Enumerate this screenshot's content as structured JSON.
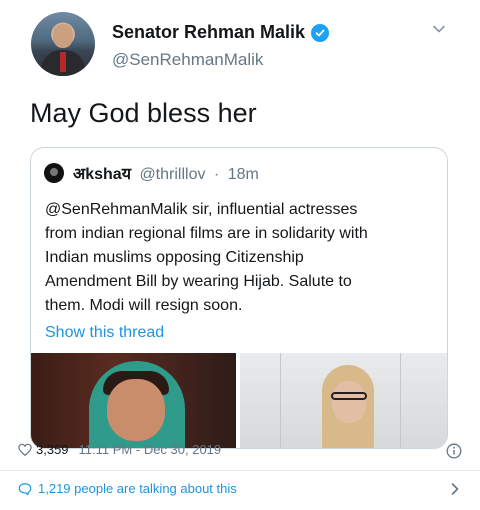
{
  "tweet": {
    "author": {
      "display_name": "Senator Rehman Malik",
      "handle": "@SenRehmanMalik",
      "verified": true
    },
    "text": "May God bless her",
    "quoted": {
      "display_name": "अkshaय",
      "handle": "@thrilllov",
      "separator": "·",
      "time": "18m",
      "body_lines": [
        "@SenRehmanMalik sir, influential actresses",
        "from indian regional films are in solidarity with",
        "Indian muslims opposing Citizenship",
        "Amendment Bill by wearing Hijab. Salute to",
        "them. Modi will resign soon."
      ],
      "show_thread": "Show this thread"
    },
    "likes": "3,359",
    "timestamp": "11:11 PM - Dec 30, 2019",
    "talking": "1,219 people are talking about this"
  },
  "icons": {
    "verified": "verified-badge-icon",
    "caret": "chevron-down-icon",
    "like": "heart-icon",
    "info": "info-icon",
    "reply": "speech-bubble-icon",
    "more": "chevron-right-icon"
  },
  "colors": {
    "accent": "#1b95e0",
    "verified": "#1da1f2",
    "secondary_text": "#657786",
    "primary_text": "#14171a",
    "border": "#ccd6dd"
  }
}
